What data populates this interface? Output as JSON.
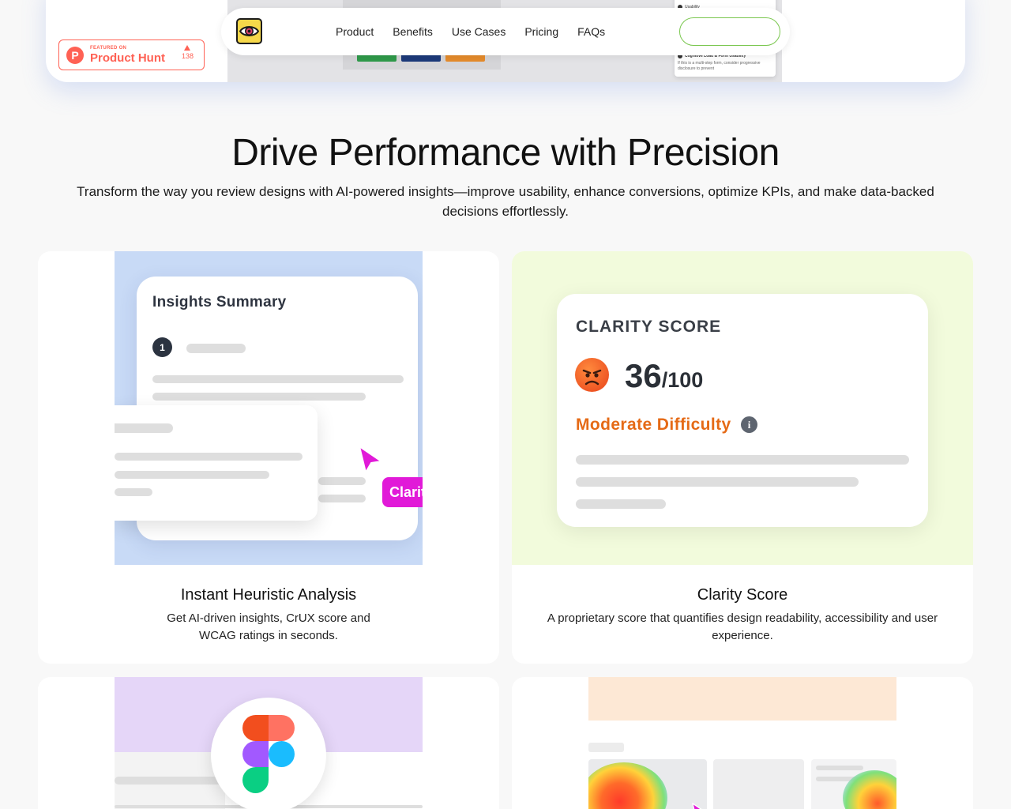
{
  "product_hunt": {
    "small": "FEATURED ON",
    "big": "Product Hunt",
    "count": "138",
    "logo_letter": "P"
  },
  "nav": {
    "logo_icon": "eye-icon",
    "links": [
      "Product",
      "Benefits",
      "Use Cases",
      "Pricing",
      "FAQs"
    ],
    "cta_label": ""
  },
  "hero_preview": {
    "card_items": [
      "Usability",
      "Cognitive Load & Form Usability"
    ],
    "card_note": "If this is a multi-step form, consider progressive disclosure to prevent"
  },
  "section": {
    "title": "Drive Performance with Precision",
    "subtitle": "Transform the way you review designs with AI-powered insights—improve usability, enhance conversions, optimize KPIs, and make data-backed decisions effortlessly."
  },
  "cards": [
    {
      "title": "Instant Heuristic Analysis",
      "desc": "Get AI-driven insights, CrUX score and WCAG ratings in seconds.",
      "visual": {
        "heading": "Insights Summary",
        "item_number": "1",
        "tag": "Clarity"
      }
    },
    {
      "title": "Clarity Score",
      "desc": "A proprietary score that quantifies design readability, accessibility and user experience.",
      "visual": {
        "label": "CLARITY SCORE",
        "score": "36",
        "out_of": "/100",
        "level": "Moderate Difficulty",
        "emoji": "angry-face-icon"
      }
    },
    {
      "visual": {
        "icon": "figma-icon"
      }
    },
    {
      "visual": {
        "icon": "heatmap-preview"
      }
    }
  ],
  "colors": {
    "accent_pink": "#e11ad8",
    "product_hunt": "#ff6154",
    "cta_border": "#7ac74f",
    "difficulty": "#e56a16"
  }
}
